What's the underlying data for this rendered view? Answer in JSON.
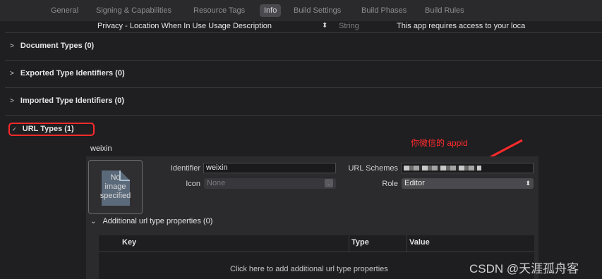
{
  "tabs": [
    {
      "label": "General",
      "active": false
    },
    {
      "label": "Signing & Capabilities",
      "active": false
    },
    {
      "label": "Resource Tags",
      "active": false
    },
    {
      "label": "Info",
      "active": true
    },
    {
      "label": "Build Settings",
      "active": false
    },
    {
      "label": "Build Phases",
      "active": false
    },
    {
      "label": "Build Rules",
      "active": false
    }
  ],
  "privacy_row": {
    "key": "Privacy - Location When In Use Usage Description",
    "type": "String",
    "value": "This app requires access to your loca"
  },
  "sections": {
    "document_types": "Document Types (0)",
    "exported_type_identifiers": "Exported Type Identifiers (0)",
    "imported_type_identifiers": "Imported Type Identifiers (0)",
    "url_types": "URL Types (1)"
  },
  "url_type": {
    "name": "weixin",
    "image_placeholder_lines": [
      "No",
      "image",
      "specified"
    ],
    "identifier_label": "Identifier",
    "identifier_value": "weixin",
    "icon_label": "Icon",
    "icon_value": "None",
    "url_schemes_label": "URL Schemes",
    "url_schemes_value": "",
    "role_label": "Role",
    "role_value": "Editor"
  },
  "additional_props": {
    "title": "Additional url type properties (0)",
    "columns": [
      "Key",
      "Type",
      "Value"
    ],
    "empty_hint": "Click here to add additional url type properties"
  },
  "annotation": {
    "text": "你微信的 appid",
    "color": "#ff2b2b"
  },
  "watermark": "CSDN @天涯孤舟客",
  "colors": {
    "highlight": "#ff2b2b",
    "background": "#1f1e21",
    "tab_active": "#4a494e"
  }
}
